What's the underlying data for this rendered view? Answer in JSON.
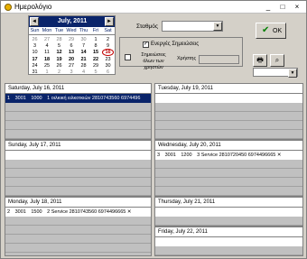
{
  "window": {
    "title": "Ημερολόγιο",
    "minimize": "_",
    "maximize": "□",
    "close": "×"
  },
  "calendar": {
    "month_title": "July, 2011",
    "prev": "◄",
    "next": "►",
    "weekdays": [
      "Sun",
      "Mon",
      "Tue",
      "Wed",
      "Thu",
      "Fri",
      "Sat"
    ],
    "weeks": [
      [
        "26",
        "27",
        "28",
        "29",
        "30",
        "1",
        "2"
      ],
      [
        "3",
        "4",
        "5",
        "6",
        "7",
        "8",
        "9"
      ],
      [
        "10",
        "11",
        "12",
        "13",
        "14",
        "15",
        "16"
      ],
      [
        "17",
        "18",
        "19",
        "20",
        "21",
        "22",
        "23"
      ],
      [
        "24",
        "25",
        "26",
        "27",
        "28",
        "29",
        "30"
      ],
      [
        "31",
        "1",
        "2",
        "3",
        "4",
        "5",
        "6"
      ]
    ],
    "selected_day": "16"
  },
  "station": {
    "label": "Σταθμός",
    "value": ""
  },
  "ok_button": {
    "label": "OK",
    "icon": "check-icon"
  },
  "options": {
    "active_notes_label": "Ενεργές Σημειώσεις",
    "active_notes_checked": true,
    "all_users_notes_label_line1": "Σημειώσεις",
    "all_users_notes_label_line2": "όλων των χρηστών",
    "all_users_notes_checked": false,
    "user_label": "Χρήστης",
    "user_value": ""
  },
  "toolbar": {
    "print_icon": "printer-icon",
    "search_icon": "search-icon"
  },
  "days": {
    "sat16": {
      "header": "Saturday, July 16, 2011",
      "entries": [
        {
          "no": "1",
          "code1": "3001",
          "code2": "1000",
          "text": "1 οιλκική ειλκοτκιών 2810743560 6974496"
        }
      ]
    },
    "tue19": {
      "header": "Tuesday, July 19, 2011",
      "entries": []
    },
    "sun17": {
      "header": "Sunday, July 17, 2011",
      "entries": []
    },
    "wed20": {
      "header": "Wednesday, July 20, 2011",
      "entries": [
        {
          "no": "3",
          "code1": "3001",
          "code2": "1200",
          "text": "3 Service 2810720450 6974496665 ✕"
        }
      ]
    },
    "mon18": {
      "header": "Monday, July 18, 2011",
      "entries": [
        {
          "no": "2",
          "code1": "3001",
          "code2": "1500",
          "text": "2 Service 2810743560 6974496665 ✕"
        }
      ]
    },
    "thu21": {
      "header": "Thursday, July 21, 2011",
      "entries": []
    },
    "fri22": {
      "header": "Friday, July 22, 2011",
      "entries": []
    }
  }
}
